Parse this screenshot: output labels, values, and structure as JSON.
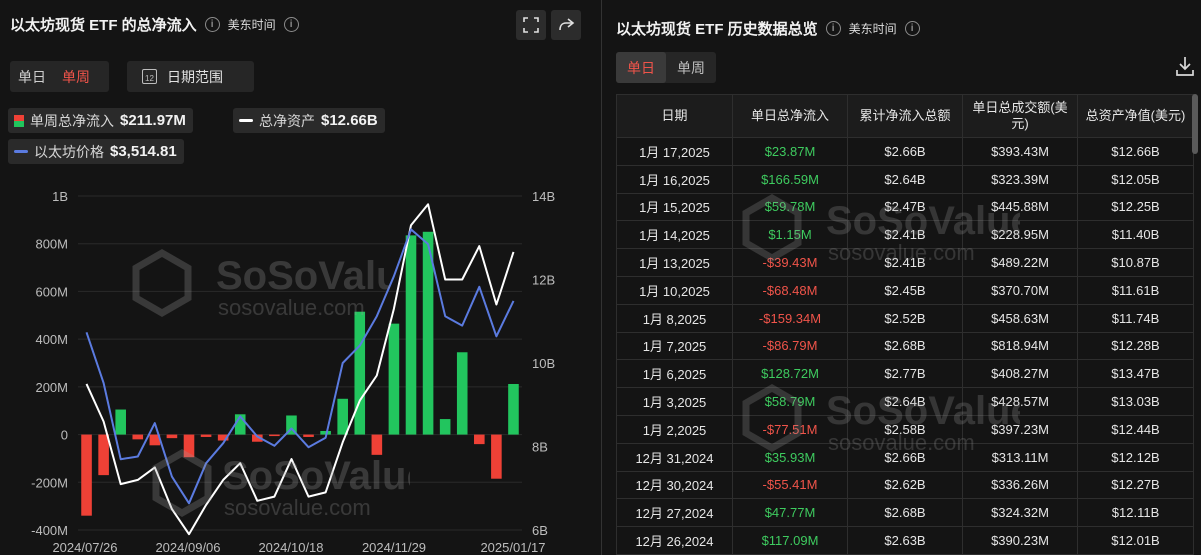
{
  "left": {
    "title": "以太坊现货 ETF 的总净流入",
    "timezone": "美东时间",
    "period_tabs": [
      "单日",
      "单周"
    ],
    "active_period": "单周",
    "date_range_label": "日期范围",
    "calendar_glyph": "12",
    "legend": {
      "flow_label": "单周总净流入",
      "flow_value": "$211.97M",
      "assets_label": "总净资产",
      "assets_value": "$12.66B",
      "price_label": "以太坊价格",
      "price_value": "$3,514.81"
    },
    "watermark": {
      "brand": "SoSoValue",
      "url": "sosovalue.com"
    }
  },
  "chart_data": {
    "type": "bar",
    "title": "以太坊现货 ETF 的总净流入",
    "y_left": {
      "ticks": [
        "1B",
        "800M",
        "600M",
        "400M",
        "200M",
        "0",
        "-200M",
        "-400M"
      ],
      "range": [
        -400,
        1000
      ],
      "unit": "M"
    },
    "y_right": {
      "ticks": [
        "14B",
        "12B",
        "10B",
        "8B",
        "6B"
      ],
      "range": [
        6,
        14
      ],
      "unit": "B"
    },
    "x_ticks": [
      "2024/07/26",
      "2024/09/06",
      "2024/10/18",
      "2024/11/29",
      "2025/01/17"
    ],
    "series": [
      {
        "name": "单周总净流入",
        "kind": "bar",
        "colors": {
          "positive": "#22c55e",
          "negative": "#ef4136"
        },
        "values": [
          -340,
          -170,
          105,
          -20,
          -45,
          -15,
          -95,
          -10,
          -25,
          85,
          -30,
          -5,
          80,
          -10,
          15,
          150,
          515,
          -85,
          465,
          835,
          850,
          65,
          345,
          -40,
          -185,
          212
        ]
      },
      {
        "name": "总净资产",
        "kind": "line",
        "color": "#ffffff",
        "values": [
          9.5,
          8.6,
          7.1,
          7.2,
          7.5,
          6.5,
          5.9,
          6.6,
          7.2,
          7.6,
          6.7,
          6.8,
          7.7,
          6.8,
          6.9,
          8.1,
          9.1,
          9.7,
          11.3,
          13.3,
          13.8,
          12.0,
          12.0,
          12.8,
          11.4,
          12.66
        ]
      },
      {
        "name": "以太坊价格",
        "kind": "line",
        "color": "#5b7be0",
        "values": [
          3280,
          2900,
          2330,
          2350,
          2600,
          2200,
          2000,
          2300,
          2450,
          2650,
          2500,
          2430,
          2560,
          2420,
          2490,
          3050,
          3180,
          3400,
          3700,
          4050,
          3940,
          3400,
          3330,
          3620,
          3250,
          3514.81
        ]
      }
    ]
  },
  "right": {
    "title": "以太坊现货 ETF 历史数据总览",
    "timezone": "美东时间",
    "tabs": [
      "单日",
      "单周"
    ],
    "active_tab": "单日",
    "columns": [
      "日期",
      "单日总净流入",
      "累计净流入总额",
      "单日总成交额(美元)",
      "总资产净值(美元)"
    ],
    "rows": [
      {
        "date": "1月 17,2025",
        "flow": "$23.87M",
        "cum": "$2.66B",
        "vol": "$393.43M",
        "nav": "$12.66B",
        "sign": "pos"
      },
      {
        "date": "1月 16,2025",
        "flow": "$166.59M",
        "cum": "$2.64B",
        "vol": "$323.39M",
        "nav": "$12.05B",
        "sign": "pos"
      },
      {
        "date": "1月 15,2025",
        "flow": "$59.78M",
        "cum": "$2.47B",
        "vol": "$445.88M",
        "nav": "$12.25B",
        "sign": "pos"
      },
      {
        "date": "1月 14,2025",
        "flow": "$1.15M",
        "cum": "$2.41B",
        "vol": "$228.95M",
        "nav": "$11.40B",
        "sign": "pos"
      },
      {
        "date": "1月 13,2025",
        "flow": "-$39.43M",
        "cum": "$2.41B",
        "vol": "$489.22M",
        "nav": "$10.87B",
        "sign": "neg"
      },
      {
        "date": "1月 10,2025",
        "flow": "-$68.48M",
        "cum": "$2.45B",
        "vol": "$370.70M",
        "nav": "$11.61B",
        "sign": "neg"
      },
      {
        "date": "1月 8,2025",
        "flow": "-$159.34M",
        "cum": "$2.52B",
        "vol": "$458.63M",
        "nav": "$11.74B",
        "sign": "neg"
      },
      {
        "date": "1月 7,2025",
        "flow": "-$86.79M",
        "cum": "$2.68B",
        "vol": "$818.94M",
        "nav": "$12.28B",
        "sign": "neg"
      },
      {
        "date": "1月 6,2025",
        "flow": "$128.72M",
        "cum": "$2.77B",
        "vol": "$408.27M",
        "nav": "$13.47B",
        "sign": "pos"
      },
      {
        "date": "1月 3,2025",
        "flow": "$58.79M",
        "cum": "$2.64B",
        "vol": "$428.57M",
        "nav": "$13.03B",
        "sign": "pos"
      },
      {
        "date": "1月 2,2025",
        "flow": "-$77.51M",
        "cum": "$2.58B",
        "vol": "$397.23M",
        "nav": "$12.44B",
        "sign": "neg"
      },
      {
        "date": "12月 31,2024",
        "flow": "$35.93M",
        "cum": "$2.66B",
        "vol": "$313.11M",
        "nav": "$12.12B",
        "sign": "pos"
      },
      {
        "date": "12月 30,2024",
        "flow": "-$55.41M",
        "cum": "$2.62B",
        "vol": "$336.26M",
        "nav": "$12.27B",
        "sign": "neg"
      },
      {
        "date": "12月 27,2024",
        "flow": "$47.77M",
        "cum": "$2.68B",
        "vol": "$324.32M",
        "nav": "$12.11B",
        "sign": "pos"
      },
      {
        "date": "12月 26,2024",
        "flow": "$117.09M",
        "cum": "$2.63B",
        "vol": "$390.23M",
        "nav": "$12.01B",
        "sign": "pos"
      }
    ]
  }
}
